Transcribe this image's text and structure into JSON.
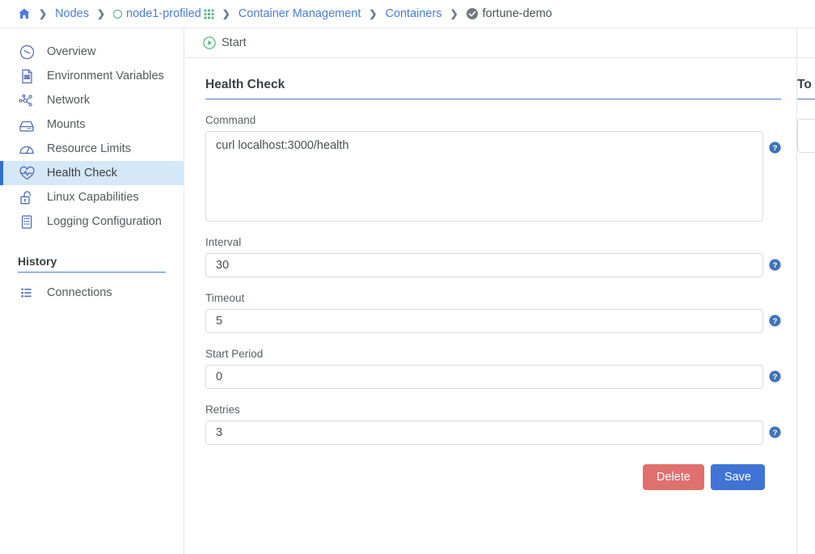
{
  "breadcrumb": {
    "home_icon": "home-icon",
    "items": [
      {
        "label": "Nodes",
        "icon": null,
        "trailing_icon": null,
        "current": false
      },
      {
        "label": "node1-profiled",
        "icon": "node-status-circle-icon",
        "trailing_icon": "grid-icon",
        "current": false
      },
      {
        "label": "Container Management",
        "icon": null,
        "trailing_icon": null,
        "current": false
      },
      {
        "label": "Containers",
        "icon": null,
        "trailing_icon": null,
        "current": false
      },
      {
        "label": "fortune-demo",
        "icon": "check-circle-icon",
        "trailing_icon": null,
        "current": true
      }
    ],
    "separator": "❯"
  },
  "sidebar": {
    "items": [
      {
        "label": "Overview",
        "icon": "overview-icon",
        "active": false
      },
      {
        "label": "Environment Variables",
        "icon": "env-vars-icon",
        "active": false
      },
      {
        "label": "Network",
        "icon": "network-icon",
        "active": false
      },
      {
        "label": "Mounts",
        "icon": "mounts-icon",
        "active": false
      },
      {
        "label": "Resource Limits",
        "icon": "gauge-icon",
        "active": false
      },
      {
        "label": "Health Check",
        "icon": "heartbeat-icon",
        "active": true
      },
      {
        "label": "Linux Capabilities",
        "icon": "unlock-icon",
        "active": false
      },
      {
        "label": "Logging Configuration",
        "icon": "log-list-icon",
        "active": false
      }
    ],
    "history": {
      "title": "History",
      "items": [
        {
          "label": "Connections",
          "icon": "list-icon"
        }
      ]
    }
  },
  "toolbar": {
    "start_label": "Start",
    "start_icon": "play-circle-icon"
  },
  "main": {
    "title": "Health Check",
    "fields": [
      {
        "label": "Command",
        "value": "curl localhost:3000/health",
        "type": "textarea",
        "help_icon": "help-circle-icon"
      },
      {
        "label": "Interval",
        "value": "30",
        "type": "input",
        "help_icon": "help-circle-icon"
      },
      {
        "label": "Timeout",
        "value": "5",
        "type": "input",
        "help_icon": "help-circle-icon"
      },
      {
        "label": "Start Period",
        "value": "0",
        "type": "input",
        "help_icon": "help-circle-icon"
      },
      {
        "label": "Retries",
        "value": "3",
        "type": "input",
        "help_icon": "help-circle-icon"
      }
    ],
    "delete_label": "Delete",
    "save_label": "Save"
  },
  "right_panel": {
    "title": "To"
  },
  "colors": {
    "accent_blue": "#4a7ddb",
    "active_item_bg": "#d5e8f7",
    "active_item_bar": "#2f6fd0",
    "delete_red": "#e0706e",
    "save_blue": "#3f74d4",
    "status_green": "#4fae7e",
    "help_blue": "#3f74b8",
    "text_primary": "#3a3f44",
    "text_secondary": "#55595e",
    "border_gray": "#d7dade"
  }
}
